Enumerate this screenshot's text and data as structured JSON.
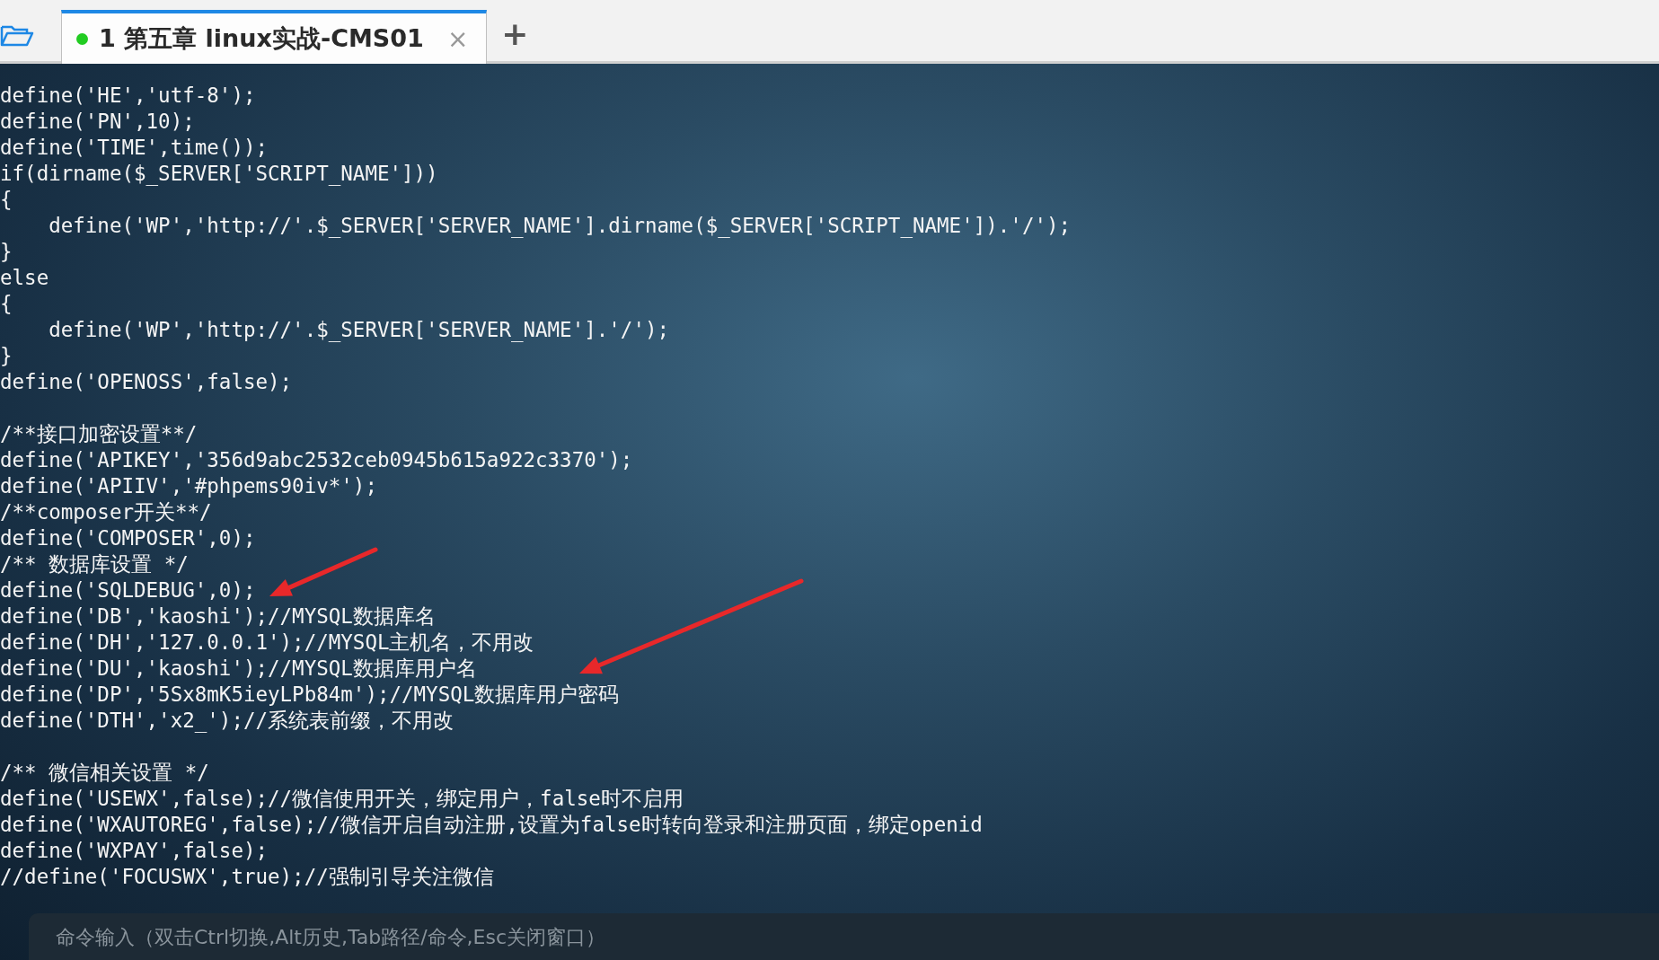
{
  "tabs": [
    {
      "label": "1 第五章 linux实战-CMS01",
      "selected": true,
      "color": "#22cc22",
      "close": "×"
    }
  ],
  "new_tab": "+",
  "code_lines": [
    {
      "kind": "code",
      "text": "define('HE','utf-8');"
    },
    {
      "kind": "code",
      "text": "define('PN',10);"
    },
    {
      "kind": "code",
      "text": "define('TIME',time());"
    },
    {
      "kind": "code",
      "text": "if(dirname($_SERVER['SCRIPT_NAME']))"
    },
    {
      "kind": "code",
      "text": "{"
    },
    {
      "kind": "code",
      "text": "    define('WP','http://'.$_SERVER['SERVER_NAME'].dirname($_SERVER['SCRIPT_NAME']).'/');"
    },
    {
      "kind": "code",
      "text": "}"
    },
    {
      "kind": "code",
      "text": "else"
    },
    {
      "kind": "code",
      "text": "{"
    },
    {
      "kind": "code",
      "text": "    define('WP','http://'.$_SERVER['SERVER_NAME'].'/');"
    },
    {
      "kind": "code",
      "text": "}"
    },
    {
      "kind": "code",
      "text": "define('OPENOSS',false);"
    },
    {
      "kind": "blank"
    },
    {
      "kind": "code",
      "text": "/**接口加密设置**/"
    },
    {
      "kind": "code",
      "text": "define('APIKEY','356d9abc2532ceb0945b615a922c3370');"
    },
    {
      "kind": "code",
      "text": "define('APIIV','#phpems90iv*');"
    },
    {
      "kind": "code",
      "text": "/**composer开关**/"
    },
    {
      "kind": "code",
      "text": "define('COMPOSER',0);"
    },
    {
      "kind": "code",
      "text": "/** 数据库设置 */"
    },
    {
      "kind": "code",
      "text": "define('SQLDEBUG',0);"
    },
    {
      "kind": "code",
      "text": "define('DB','kaoshi');//MYSQL数据库名"
    },
    {
      "kind": "code",
      "text": "define('DH','127.0.0.1');//MYSQL主机名，不用改"
    },
    {
      "kind": "code",
      "text": "define('DU','kaoshi');//MYSQL数据库用户名"
    },
    {
      "kind": "code",
      "text": "define('DP','5Sx8mK5ieyLPb84m');//MYSQL数据库用户密码"
    },
    {
      "kind": "code",
      "text": "define('DTH','x2_');//系统表前缀，不用改"
    },
    {
      "kind": "blank"
    },
    {
      "kind": "code",
      "text": "/** 微信相关设置 */"
    },
    {
      "kind": "code",
      "text": "define('USEWX',false);//微信使用开关，绑定用户，false时不启用"
    },
    {
      "kind": "code",
      "text": "define('WXAUTOREG',false);//微信开启自动注册,设置为false时转向登录和注册页面，绑定openid"
    },
    {
      "kind": "code",
      "text": "define('WXPAY',false);"
    },
    {
      "kind": "code",
      "text": "//define('FOCUSWX',true);//强制引导关注微信"
    }
  ],
  "command_input": {
    "placeholder": "命令输入（双击Ctrl切换,Alt历史,Tab路径/命令,Esc关闭窗口）"
  }
}
